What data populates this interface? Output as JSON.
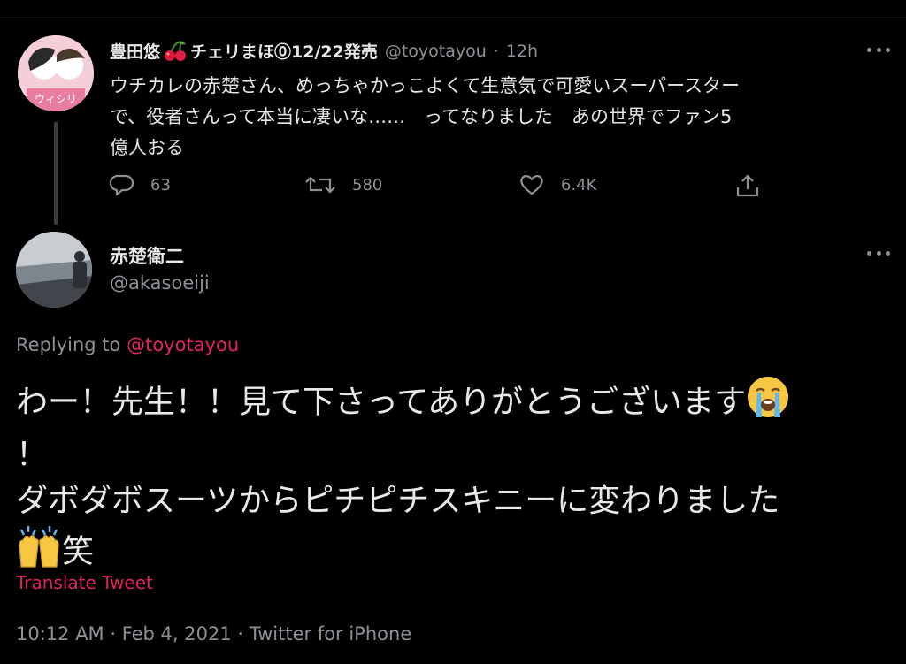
{
  "parent_tweet": {
    "author_name": "豊田悠",
    "author_name_suffix": "チェリまほ⓪12/22発売",
    "handle": "@toyotayou",
    "separator": "·",
    "time": "12h",
    "text_lines": [
      "ウチカレの赤楚さん、めっちゃかっこよくて生意気で可愛いスーパースター",
      "で、役者さんって本当に凄いな……　ってなりました　あの世界でファン5",
      "億人おる"
    ],
    "avatar_text": "ウィシリ",
    "replies_count": "63",
    "retweets_count": "580",
    "likes_count": "6.4K"
  },
  "reply_tweet": {
    "author_name": "赤楚衛二",
    "handle": "@akasoeiji",
    "replying_prefix": "Replying to",
    "replying_handle": "@toyotayou",
    "line1": "わー！先生！！見て下さってありがとうございます",
    "line2": "！",
    "line3": "ダボダボスーツからピチピチスキニーに変わりました",
    "line4_suffix": "笑",
    "translate_label": "Translate Tweet",
    "meta": "10:12 AM · Feb 4, 2021 · Twitter for iPhone"
  },
  "icons": {
    "cherry": "cherry-emoji",
    "reply": "reply-icon",
    "retweet": "retweet-icon",
    "like": "heart-icon",
    "share": "share-icon",
    "more": "more-icon",
    "crying": "loudly-crying-face-emoji",
    "raising_hands": "raising-hands-emoji"
  },
  "colors": {
    "background": "#000000",
    "text": "#e8e8e8",
    "secondary": "#8b9196",
    "accent": "#e0245e"
  }
}
